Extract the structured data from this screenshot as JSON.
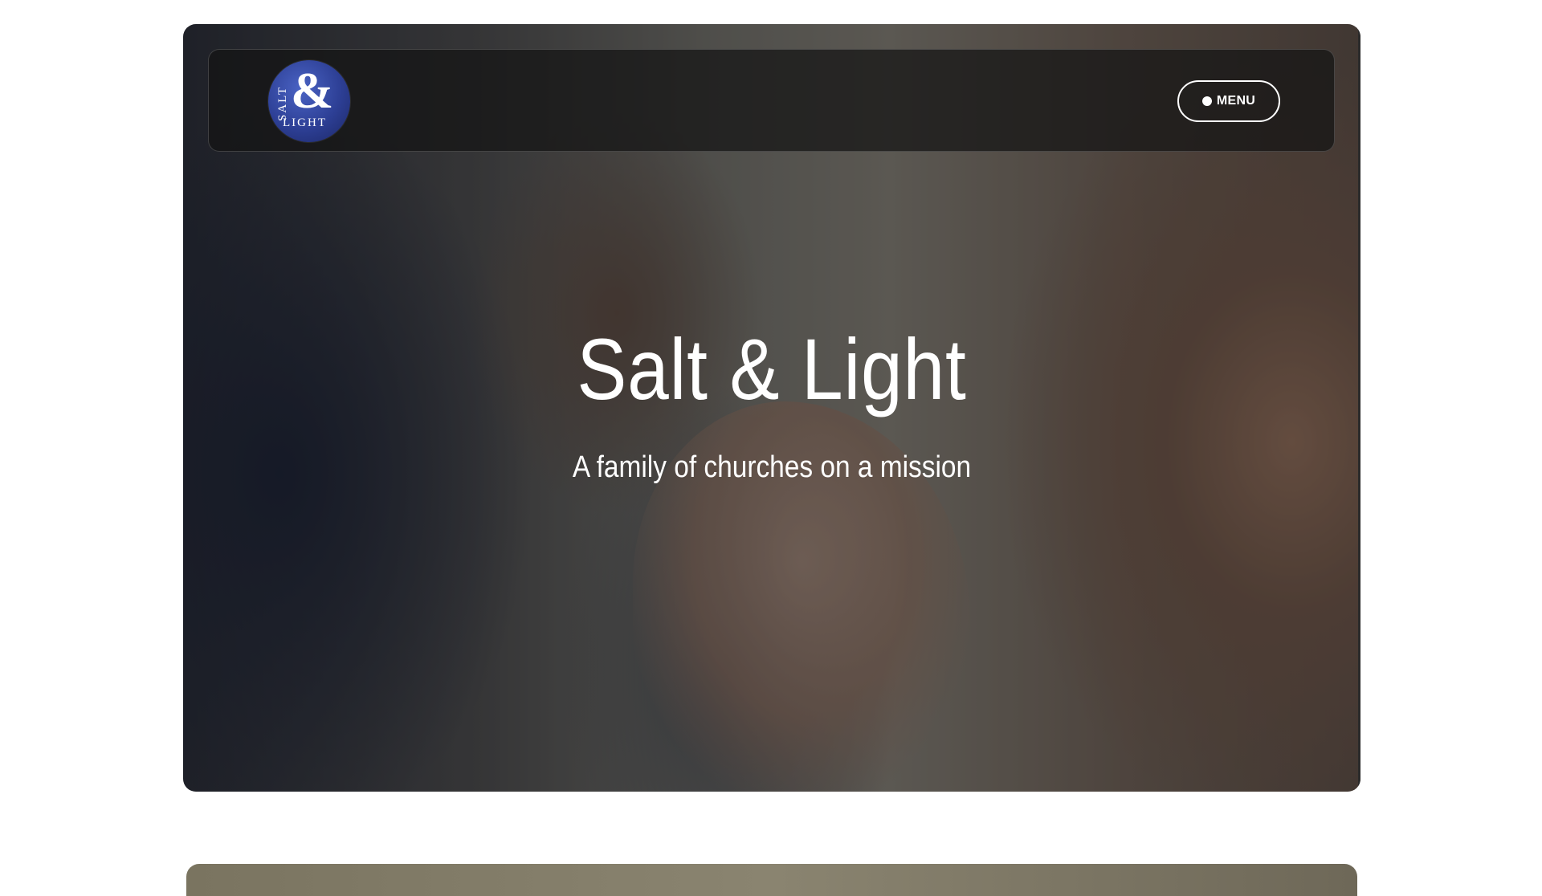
{
  "header": {
    "logo": {
      "alt": "Salt & Light",
      "top_word": "SALT",
      "ampersand": "&",
      "bottom_word": "LIGHT",
      "colors": {
        "badge": "#2d3f95",
        "text": "#ffffff"
      }
    },
    "menu_button": {
      "label": "MENU",
      "icon": "dot-icon"
    }
  },
  "hero": {
    "title": "Salt & Light",
    "subtitle": "A family of churches on a mission",
    "background_image": "worship-crowd-photo"
  },
  "colors": {
    "page_background": "#ffffff",
    "navbar_background": "#141414",
    "text": "#ffffff"
  }
}
